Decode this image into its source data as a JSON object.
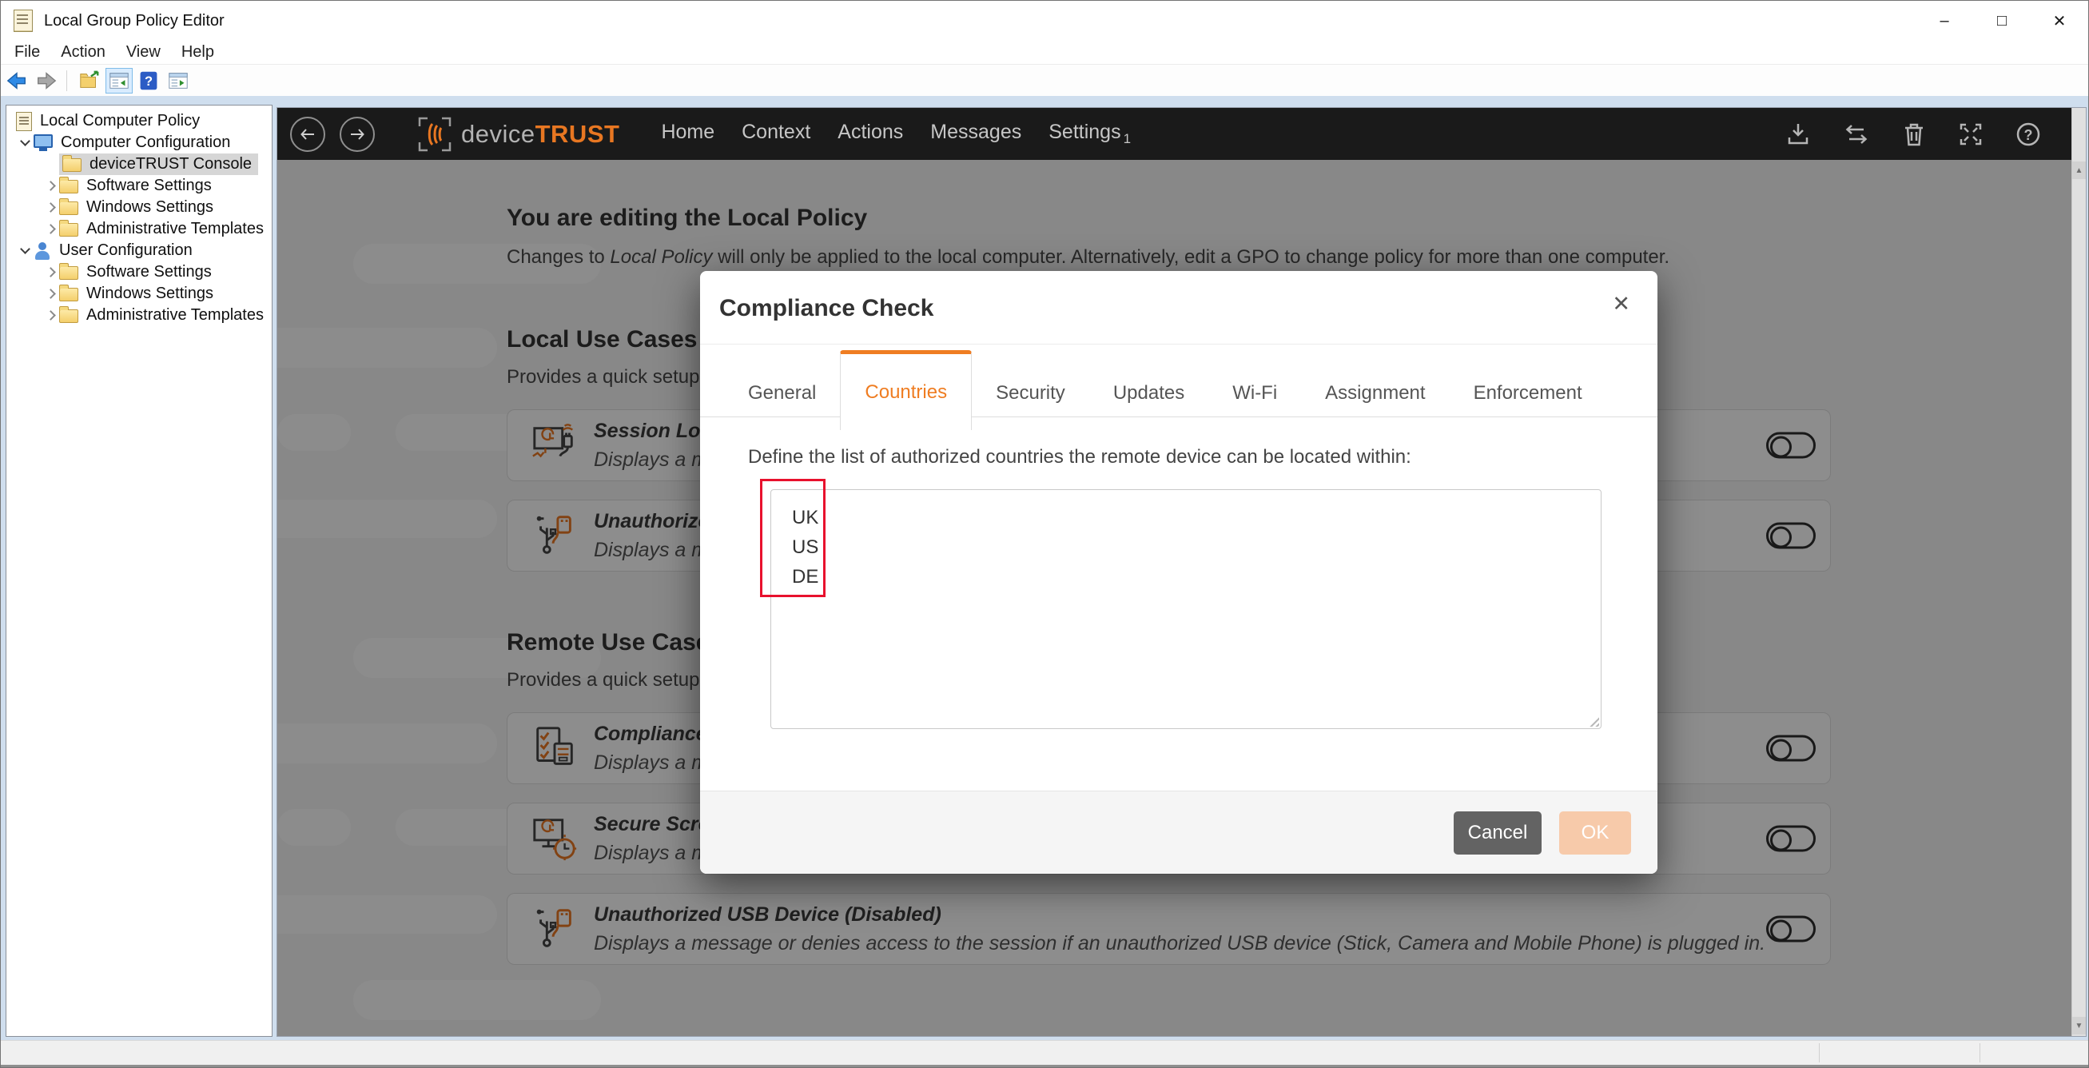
{
  "window": {
    "title": "Local Group Policy Editor",
    "controls": {
      "minimize": "–",
      "maximize": "□",
      "close": "✕"
    }
  },
  "menu": {
    "items": [
      "File",
      "Action",
      "View",
      "Help"
    ]
  },
  "toolbar": {
    "icons": [
      "back-icon",
      "forward-icon",
      "export-list-icon",
      "show-console-tree-icon",
      "help-icon",
      "show-action-pane-icon"
    ],
    "selected_icon": "show-console-tree-icon"
  },
  "tree": {
    "items": [
      {
        "label": "Local Computer Policy",
        "icon": "policy-scroll",
        "level": 0,
        "chevron": "none",
        "selected": false
      },
      {
        "label": "Computer Configuration",
        "icon": "computer",
        "level": 0,
        "chevron": "expanded",
        "selected": false
      },
      {
        "label": "deviceTRUST Console",
        "icon": "folder",
        "level": 1,
        "chevron": "none",
        "selected": true
      },
      {
        "label": "Software Settings",
        "icon": "folder",
        "level": 1,
        "chevron": "collapsed",
        "selected": false
      },
      {
        "label": "Windows Settings",
        "icon": "folder",
        "level": 1,
        "chevron": "collapsed",
        "selected": false
      },
      {
        "label": "Administrative Templates",
        "icon": "folder",
        "level": 1,
        "chevron": "collapsed",
        "selected": false
      },
      {
        "label": "User Configuration",
        "icon": "user",
        "level": 0,
        "chevron": "expanded",
        "selected": false
      },
      {
        "label": "Software Settings",
        "icon": "folder",
        "level": 1,
        "chevron": "collapsed",
        "selected": false
      },
      {
        "label": "Windows Settings",
        "icon": "folder",
        "level": 1,
        "chevron": "collapsed",
        "selected": false
      },
      {
        "label": "Administrative Templates",
        "icon": "folder",
        "level": 1,
        "chevron": "collapsed",
        "selected": false
      }
    ]
  },
  "console": {
    "brand": {
      "device": "device",
      "trust": "TRUST"
    },
    "nav": [
      {
        "label": "Home"
      },
      {
        "label": "Context"
      },
      {
        "label": "Actions"
      },
      {
        "label": "Messages"
      },
      {
        "label": "Settings",
        "badge": "1"
      }
    ],
    "header_icons": [
      "download-icon",
      "transfer-icon",
      "delete-icon",
      "fullscreen-icon",
      "help-icon"
    ],
    "page": {
      "title": "You are editing the Local Policy",
      "subtitle_prefix": "Changes to ",
      "subtitle_italic": "Local Policy",
      "subtitle_suffix": " will only be applied to the local computer. Alternatively, edit a GPO to change policy for more than one computer."
    },
    "sections": [
      {
        "title": "Local Use Cases",
        "subtitle": "Provides a quick setup f",
        "cards": [
          {
            "icon": "session-lock-icon",
            "title": "Session Lock E",
            "desc": "Displays a mes",
            "toggle_on": false
          },
          {
            "icon": "usb-device-icon",
            "title": "Unauthorized",
            "desc": "Displays a mes",
            "toggle_on": false
          }
        ]
      },
      {
        "title": "Remote Use Cases",
        "subtitle": "Provides a quick setup t",
        "cards": [
          {
            "icon": "compliance-icon",
            "title": "Compliance C",
            "desc": "Displays a mes",
            "toggle_on": false
          },
          {
            "icon": "secure-screen-icon",
            "title": "Secure Screen",
            "desc": "Displays a mes",
            "toggle_on": false
          },
          {
            "icon": "usb-device-icon",
            "title": "Unauthorized USB Device (Disabled)",
            "desc": "Displays a message or denies access to the session if an unauthorized USB device (Stick, Camera and Mobile Phone) is plugged in.",
            "toggle_on": false
          }
        ]
      }
    ],
    "scrollbar": {
      "up": "▲",
      "down": "▼"
    }
  },
  "dialog": {
    "title": "Compliance Check",
    "close": "✕",
    "tabs": [
      "General",
      "Countries",
      "Security",
      "Updates",
      "Wi-Fi",
      "Assignment",
      "Enforcement"
    ],
    "active_tab": "Countries",
    "label": "Define the list of authorized countries the remote device can be located within:",
    "countries": [
      "UK",
      "US",
      "DE"
    ],
    "buttons": {
      "cancel": "Cancel",
      "ok": "OK"
    }
  },
  "colors": {
    "accent_orange": "#ef7d22",
    "annotation_red": "#e8112d",
    "nav_background": "#1a1a1a",
    "cancel_button": "#636363",
    "ok_button_disabled": "#f7caaa"
  }
}
